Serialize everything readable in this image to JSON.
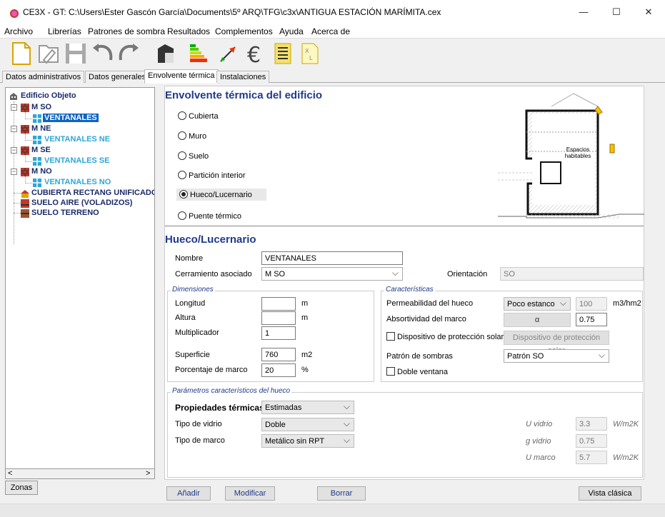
{
  "window": {
    "title": "CE3X - GT: C:\\Users\\Ester Gascón García\\Documents\\5º ARQ\\TFG\\c3x\\ANTIGUA ESTACIÓN MARÍMITA.cex",
    "min": "—",
    "max": "☐",
    "close": "✕"
  },
  "menu": [
    "Archivo",
    "Librerías",
    "Patrones de sombra",
    "Resultados",
    "Complementos",
    "Ayuda",
    "Acerca de"
  ],
  "tabs": [
    "Datos administrativos",
    "Datos generales",
    "Envolvente térmica",
    "Instalaciones"
  ],
  "tree": {
    "root": "Edificio Objeto",
    "items": [
      {
        "label": "M SO",
        "child": "VENTANALES"
      },
      {
        "label": "M NE",
        "child": "VENTANALES NE"
      },
      {
        "label": "M SE",
        "child": "VENTANALES SE"
      },
      {
        "label": "M NO",
        "child": "VENTANALES NO"
      }
    ],
    "extra": [
      "CUBIERTA RECTANG UNIFICADO",
      "SUELO AIRE (VOLADIZOS)",
      "SUELO TERRENO"
    ],
    "scroll_left": "<",
    "scroll_right": ">"
  },
  "zonas_button": "Zonas",
  "envolvente": {
    "title": "Envolvente térmica del edificio",
    "options": [
      "Cubierta",
      "Muro",
      "Suelo",
      "Partición interior",
      "Hueco/Lucernario",
      "Puente térmico"
    ],
    "selected": "Hueco/Lucernario",
    "diagram_label_1": "Espacios",
    "diagram_label_2": "habitables"
  },
  "hueco": {
    "title": "Hueco/Lucernario",
    "nombre_label": "Nombre",
    "nombre_value": "VENTANALES",
    "cerramiento_label": "Cerramiento asociado",
    "cerramiento_value": "M SO",
    "orientacion_label": "Orientación",
    "orientacion_value": "SO"
  },
  "dimensiones": {
    "title": "Dimensiones",
    "longitud_label": "Longitud",
    "longitud_value": "",
    "longitud_unit": "m",
    "altura_label": "Altura",
    "altura_value": "",
    "altura_unit": "m",
    "multiplicador_label": "Multiplicador",
    "multiplicador_value": "1",
    "superficie_label": "Superficie",
    "superficie_value": "760",
    "superficie_unit": "m2",
    "porcentaje_label": "Porcentaje de marco",
    "porcentaje_value": "20",
    "porcentaje_unit": "%"
  },
  "caracteristicas": {
    "title": "Características",
    "permeabilidad_label": "Permeabilidad del hueco",
    "permeabilidad_value": "Poco estanco",
    "permeabilidad_num": "100",
    "permeabilidad_unit": "m3/hm2",
    "absortividad_label": "Absortividad del marco",
    "absortividad_btn": "α",
    "absortividad_value": "0.75",
    "dispositivo_label": "Dispositivo de protección solar",
    "dispositivo_btn": "Dispositivo de protección solar",
    "patron_label": "Patrón de sombras",
    "patron_value": "Patrón SO",
    "doble_label": "Doble ventana"
  },
  "parametros": {
    "title": "Parámetros característicos del hueco",
    "propiedades_label": "Propiedades térmicas",
    "propiedades_value": "Estimadas",
    "vidrio_label": "Tipo de vidrio",
    "vidrio_value": "Doble",
    "marco_label": "Tipo de marco",
    "marco_value": "Metálico sin RPT",
    "u_vidrio_label": "U vidrio",
    "u_vidrio_value": "3.3",
    "u_vidrio_unit": "W/m2K",
    "g_vidrio_label": "g vidrio",
    "g_vidrio_value": "0.75",
    "u_marco_label": "U marco",
    "u_marco_value": "5.7",
    "u_marco_unit": "W/m2K"
  },
  "buttons": {
    "anadir": "Añadir",
    "modificar": "Modificar",
    "borrar": "Borrar",
    "vista": "Vista clásica"
  }
}
